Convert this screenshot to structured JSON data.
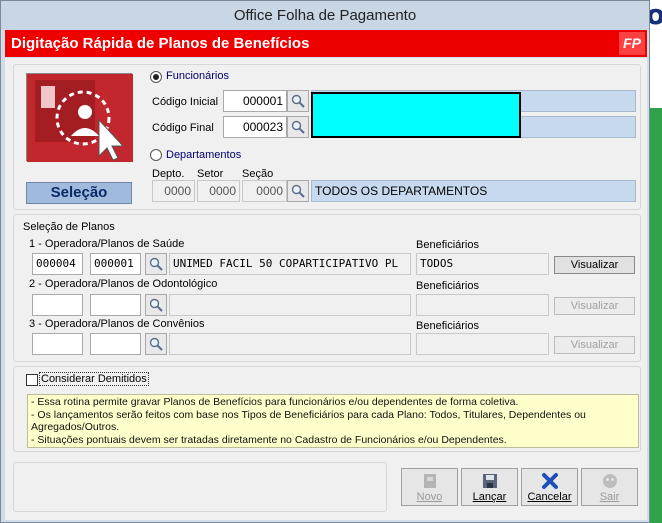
{
  "window": {
    "title": "Office Folha de Pagamento",
    "header_title": "Digitação Rápida de Planos de Benefícios",
    "header_badge": "FP"
  },
  "selection_panel": {
    "label": "Seleção"
  },
  "employees": {
    "radio_label": "Funcionários",
    "selected": true,
    "start_code_label": "Código Inicial",
    "start_code_value": "000001",
    "end_code_label": "Código Final",
    "end_code_value": "000023"
  },
  "departments": {
    "radio_label": "Departamentos",
    "selected": false,
    "col_dept": "Depto.",
    "col_sector": "Setor",
    "col_section": "Seção",
    "dept_value": "0000",
    "sector_value": "0000",
    "section_value": "0000",
    "description": "TODOS OS DEPARTAMENTOS"
  },
  "plans": {
    "group_label": "Seleção de Planos",
    "beneficiaries_label": "Beneficiários",
    "view_button": "Visualizar",
    "health": {
      "label": "1 - Operadora/Planos de Saúde",
      "operator_code": "000004",
      "plan_code": "000001",
      "plan_name": "UNIMED FACIL 50 COPARTICIPATIVO PL",
      "beneficiaries": "TODOS"
    },
    "dental": {
      "label": "2 - Operadora/Planos de Odontológico",
      "operator_code": "",
      "plan_code": "",
      "plan_name": "",
      "beneficiaries": ""
    },
    "agreements": {
      "label": "3 - Operadora/Planos de Convênios",
      "operator_code": "",
      "plan_code": "",
      "plan_name": "",
      "beneficiaries": ""
    }
  },
  "consider_dismissed": {
    "label": "Considerar Demitidos",
    "checked": false
  },
  "info_lines": [
    "- Essa rotina permite gravar Planos de Benefícios para funcionários e/ou dependentes de forma coletiva.",
    "- Os lançamentos serão feitos com base nos Tipos de Beneficiários para cada Plano: Todos, Titulares, Dependentes ou",
    "Agregados/Outros.",
    "- Situações pontuais devem ser tratadas diretamente no Cadastro de Funcionários e/ou Dependentes."
  ],
  "toolbar": {
    "new_label": "Novo",
    "launch_label": "Lançar",
    "cancel_label": "Cancelar",
    "exit_label": "Sair"
  },
  "colors": {
    "header_red": "#ee0000",
    "highlight_cyan": "#00ffff",
    "readonly_blue": "#c7d9ee",
    "info_yellow": "#ffffcc"
  }
}
